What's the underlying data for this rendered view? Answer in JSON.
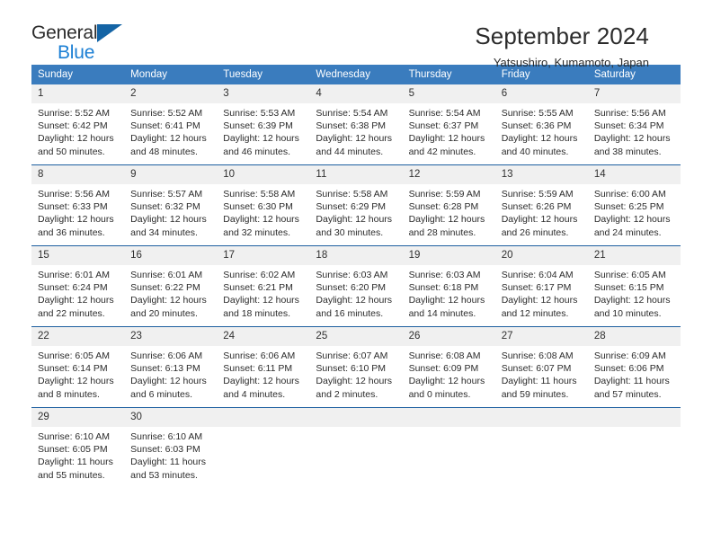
{
  "brand": {
    "name_top": "General",
    "name_bottom": "Blue",
    "triangle_color": "#1464a5",
    "bottom_color": "#1b7fd4"
  },
  "header": {
    "title": "September 2024",
    "location": "Yatsushiro, Kumamoto, Japan"
  },
  "theme": {
    "header_row_bg": "#3a7cbe",
    "row_border": "#1d5fa0",
    "daynum_bg": "#f0f0f0"
  },
  "calendar": {
    "weekday_headers": [
      "Sunday",
      "Monday",
      "Tuesday",
      "Wednesday",
      "Thursday",
      "Friday",
      "Saturday"
    ],
    "weeks": [
      [
        {
          "day": "1",
          "sunrise": "Sunrise: 5:52 AM",
          "sunset": "Sunset: 6:42 PM",
          "daylight1": "Daylight: 12 hours",
          "daylight2": "and 50 minutes."
        },
        {
          "day": "2",
          "sunrise": "Sunrise: 5:52 AM",
          "sunset": "Sunset: 6:41 PM",
          "daylight1": "Daylight: 12 hours",
          "daylight2": "and 48 minutes."
        },
        {
          "day": "3",
          "sunrise": "Sunrise: 5:53 AM",
          "sunset": "Sunset: 6:39 PM",
          "daylight1": "Daylight: 12 hours",
          "daylight2": "and 46 minutes."
        },
        {
          "day": "4",
          "sunrise": "Sunrise: 5:54 AM",
          "sunset": "Sunset: 6:38 PM",
          "daylight1": "Daylight: 12 hours",
          "daylight2": "and 44 minutes."
        },
        {
          "day": "5",
          "sunrise": "Sunrise: 5:54 AM",
          "sunset": "Sunset: 6:37 PM",
          "daylight1": "Daylight: 12 hours",
          "daylight2": "and 42 minutes."
        },
        {
          "day": "6",
          "sunrise": "Sunrise: 5:55 AM",
          "sunset": "Sunset: 6:36 PM",
          "daylight1": "Daylight: 12 hours",
          "daylight2": "and 40 minutes."
        },
        {
          "day": "7",
          "sunrise": "Sunrise: 5:56 AM",
          "sunset": "Sunset: 6:34 PM",
          "daylight1": "Daylight: 12 hours",
          "daylight2": "and 38 minutes."
        }
      ],
      [
        {
          "day": "8",
          "sunrise": "Sunrise: 5:56 AM",
          "sunset": "Sunset: 6:33 PM",
          "daylight1": "Daylight: 12 hours",
          "daylight2": "and 36 minutes."
        },
        {
          "day": "9",
          "sunrise": "Sunrise: 5:57 AM",
          "sunset": "Sunset: 6:32 PM",
          "daylight1": "Daylight: 12 hours",
          "daylight2": "and 34 minutes."
        },
        {
          "day": "10",
          "sunrise": "Sunrise: 5:58 AM",
          "sunset": "Sunset: 6:30 PM",
          "daylight1": "Daylight: 12 hours",
          "daylight2": "and 32 minutes."
        },
        {
          "day": "11",
          "sunrise": "Sunrise: 5:58 AM",
          "sunset": "Sunset: 6:29 PM",
          "daylight1": "Daylight: 12 hours",
          "daylight2": "and 30 minutes."
        },
        {
          "day": "12",
          "sunrise": "Sunrise: 5:59 AM",
          "sunset": "Sunset: 6:28 PM",
          "daylight1": "Daylight: 12 hours",
          "daylight2": "and 28 minutes."
        },
        {
          "day": "13",
          "sunrise": "Sunrise: 5:59 AM",
          "sunset": "Sunset: 6:26 PM",
          "daylight1": "Daylight: 12 hours",
          "daylight2": "and 26 minutes."
        },
        {
          "day": "14",
          "sunrise": "Sunrise: 6:00 AM",
          "sunset": "Sunset: 6:25 PM",
          "daylight1": "Daylight: 12 hours",
          "daylight2": "and 24 minutes."
        }
      ],
      [
        {
          "day": "15",
          "sunrise": "Sunrise: 6:01 AM",
          "sunset": "Sunset: 6:24 PM",
          "daylight1": "Daylight: 12 hours",
          "daylight2": "and 22 minutes."
        },
        {
          "day": "16",
          "sunrise": "Sunrise: 6:01 AM",
          "sunset": "Sunset: 6:22 PM",
          "daylight1": "Daylight: 12 hours",
          "daylight2": "and 20 minutes."
        },
        {
          "day": "17",
          "sunrise": "Sunrise: 6:02 AM",
          "sunset": "Sunset: 6:21 PM",
          "daylight1": "Daylight: 12 hours",
          "daylight2": "and 18 minutes."
        },
        {
          "day": "18",
          "sunrise": "Sunrise: 6:03 AM",
          "sunset": "Sunset: 6:20 PM",
          "daylight1": "Daylight: 12 hours",
          "daylight2": "and 16 minutes."
        },
        {
          "day": "19",
          "sunrise": "Sunrise: 6:03 AM",
          "sunset": "Sunset: 6:18 PM",
          "daylight1": "Daylight: 12 hours",
          "daylight2": "and 14 minutes."
        },
        {
          "day": "20",
          "sunrise": "Sunrise: 6:04 AM",
          "sunset": "Sunset: 6:17 PM",
          "daylight1": "Daylight: 12 hours",
          "daylight2": "and 12 minutes."
        },
        {
          "day": "21",
          "sunrise": "Sunrise: 6:05 AM",
          "sunset": "Sunset: 6:15 PM",
          "daylight1": "Daylight: 12 hours",
          "daylight2": "and 10 minutes."
        }
      ],
      [
        {
          "day": "22",
          "sunrise": "Sunrise: 6:05 AM",
          "sunset": "Sunset: 6:14 PM",
          "daylight1": "Daylight: 12 hours",
          "daylight2": "and 8 minutes."
        },
        {
          "day": "23",
          "sunrise": "Sunrise: 6:06 AM",
          "sunset": "Sunset: 6:13 PM",
          "daylight1": "Daylight: 12 hours",
          "daylight2": "and 6 minutes."
        },
        {
          "day": "24",
          "sunrise": "Sunrise: 6:06 AM",
          "sunset": "Sunset: 6:11 PM",
          "daylight1": "Daylight: 12 hours",
          "daylight2": "and 4 minutes."
        },
        {
          "day": "25",
          "sunrise": "Sunrise: 6:07 AM",
          "sunset": "Sunset: 6:10 PM",
          "daylight1": "Daylight: 12 hours",
          "daylight2": "and 2 minutes."
        },
        {
          "day": "26",
          "sunrise": "Sunrise: 6:08 AM",
          "sunset": "Sunset: 6:09 PM",
          "daylight1": "Daylight: 12 hours",
          "daylight2": "and 0 minutes."
        },
        {
          "day": "27",
          "sunrise": "Sunrise: 6:08 AM",
          "sunset": "Sunset: 6:07 PM",
          "daylight1": "Daylight: 11 hours",
          "daylight2": "and 59 minutes."
        },
        {
          "day": "28",
          "sunrise": "Sunrise: 6:09 AM",
          "sunset": "Sunset: 6:06 PM",
          "daylight1": "Daylight: 11 hours",
          "daylight2": "and 57 minutes."
        }
      ],
      [
        {
          "day": "29",
          "sunrise": "Sunrise: 6:10 AM",
          "sunset": "Sunset: 6:05 PM",
          "daylight1": "Daylight: 11 hours",
          "daylight2": "and 55 minutes."
        },
        {
          "day": "30",
          "sunrise": "Sunrise: 6:10 AM",
          "sunset": "Sunset: 6:03 PM",
          "daylight1": "Daylight: 11 hours",
          "daylight2": "and 53 minutes."
        },
        {
          "day": "",
          "sunrise": "",
          "sunset": "",
          "daylight1": "",
          "daylight2": ""
        },
        {
          "day": "",
          "sunrise": "",
          "sunset": "",
          "daylight1": "",
          "daylight2": ""
        },
        {
          "day": "",
          "sunrise": "",
          "sunset": "",
          "daylight1": "",
          "daylight2": ""
        },
        {
          "day": "",
          "sunrise": "",
          "sunset": "",
          "daylight1": "",
          "daylight2": ""
        },
        {
          "day": "",
          "sunrise": "",
          "sunset": "",
          "daylight1": "",
          "daylight2": ""
        }
      ]
    ]
  }
}
